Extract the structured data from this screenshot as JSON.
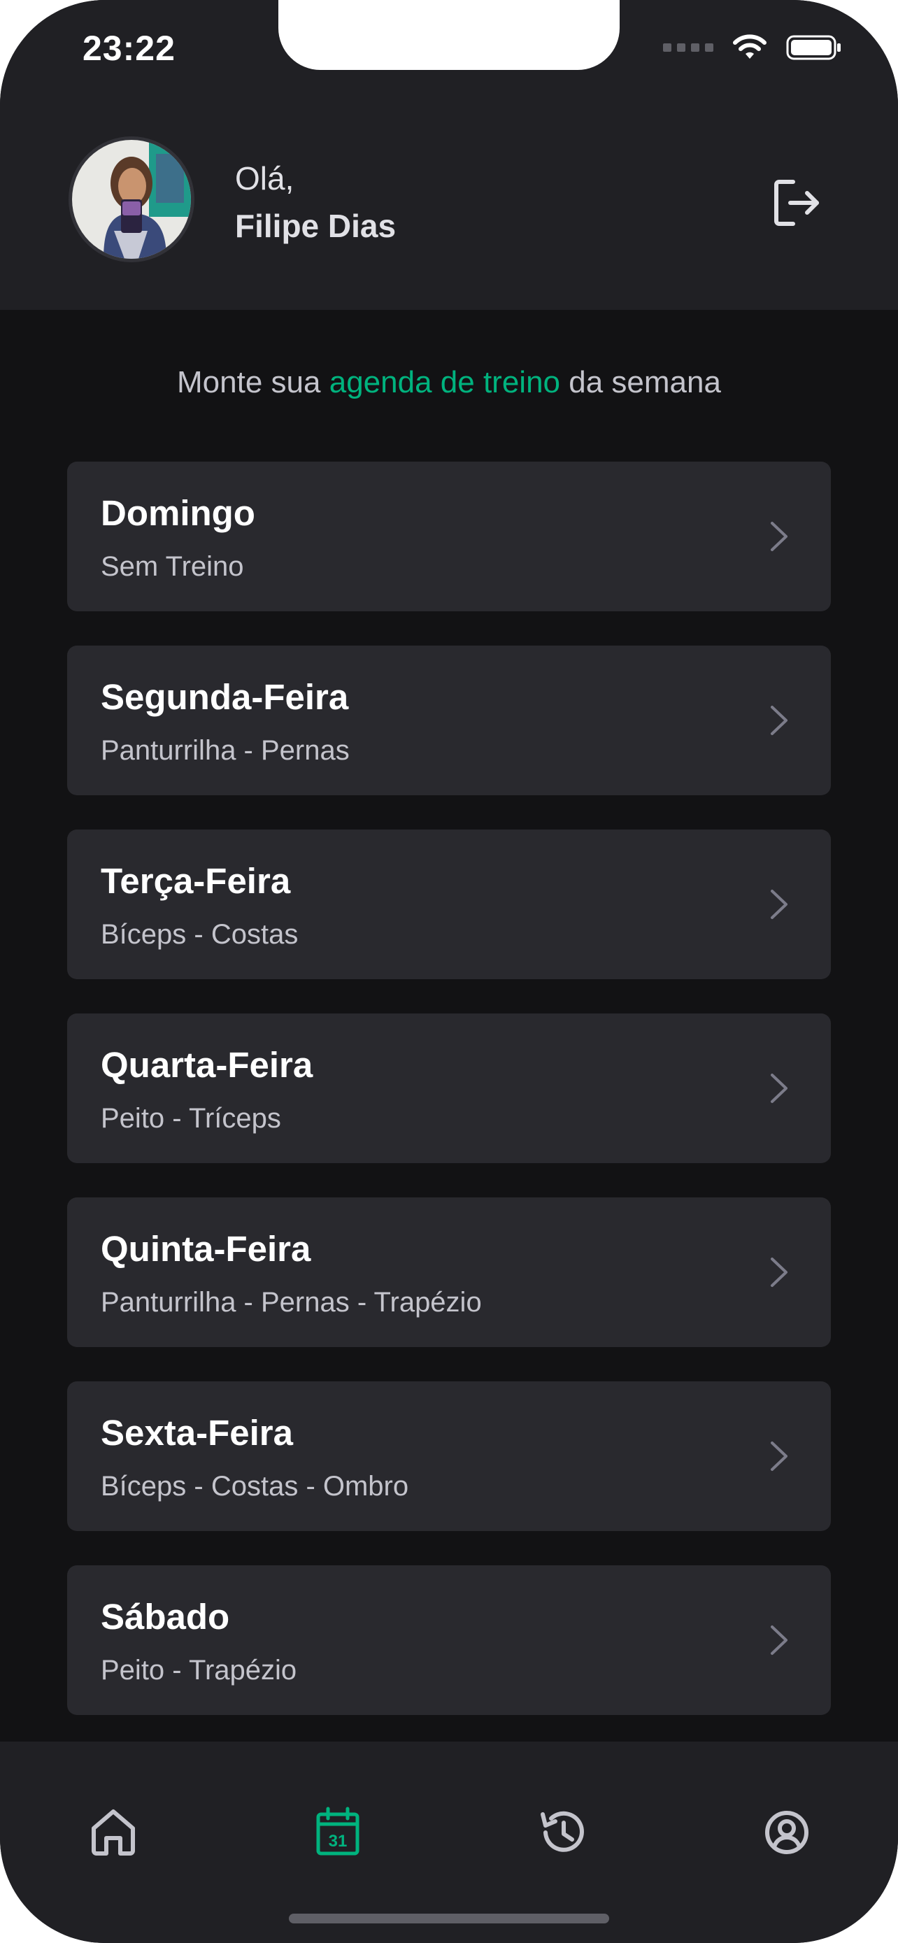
{
  "status_bar": {
    "time": "23:22"
  },
  "header": {
    "greeting": "Olá,",
    "user_name": "Filipe Dias"
  },
  "subtitle": {
    "before": "Monte sua",
    "accent": "agenda de treino",
    "after": "da semana"
  },
  "days": [
    {
      "name": "Domingo",
      "workout": "Sem Treino"
    },
    {
      "name": "Segunda-Feira",
      "workout": "Panturrilha - Pernas"
    },
    {
      "name": "Terça-Feira",
      "workout": "Bíceps - Costas"
    },
    {
      "name": "Quarta-Feira",
      "workout": "Peito - Tríceps"
    },
    {
      "name": "Quinta-Feira",
      "workout": "Panturrilha - Pernas - Trapézio"
    },
    {
      "name": "Sexta-Feira",
      "workout": "Bíceps - Costas - Ombro"
    },
    {
      "name": "Sábado",
      "workout": "Peito - Trapézio"
    }
  ],
  "tabbar": {
    "calendar_day": "31",
    "active_tab": "calendar",
    "tabs": [
      "home-icon",
      "calendar-icon",
      "history-icon",
      "profile-icon"
    ]
  },
  "colors": {
    "accent": "#00b37e",
    "background": "#121214",
    "header": "#202024",
    "card": "#29292e"
  }
}
